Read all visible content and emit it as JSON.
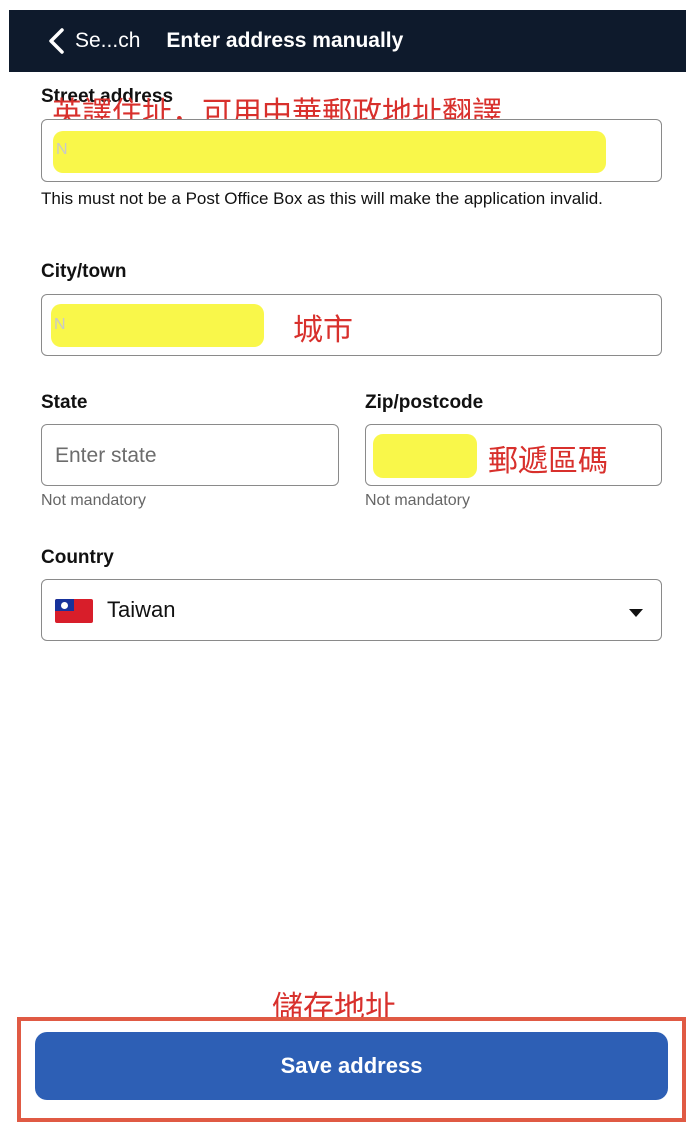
{
  "header": {
    "back_label": "Se...ch",
    "title": "Enter address manually"
  },
  "street": {
    "label": "Street address",
    "annotation": "英譯住址，可用中華郵政地址翻譯",
    "faint_value": "N",
    "hint": "This must not be a Post Office Box as this will make the application invalid."
  },
  "city": {
    "label": "City/town",
    "faint_value": "N",
    "annotation": "城市"
  },
  "state": {
    "label": "State",
    "placeholder": "Enter state",
    "sublabel": "Not mandatory"
  },
  "zip": {
    "label": "Zip/postcode",
    "annotation": "郵遞區碼",
    "sublabel": "Not mandatory"
  },
  "country": {
    "label": "Country",
    "selected": "Taiwan",
    "flag_icon": "taiwan-flag-icon"
  },
  "save": {
    "annotation": "儲存地址",
    "button_label": "Save address"
  },
  "colors": {
    "header_bg": "#0e1a2c",
    "button_bg": "#2d5fb5",
    "highlight": "#f9f74a",
    "annotation_red": "#d8302c",
    "frame_red": "#e05a44"
  }
}
